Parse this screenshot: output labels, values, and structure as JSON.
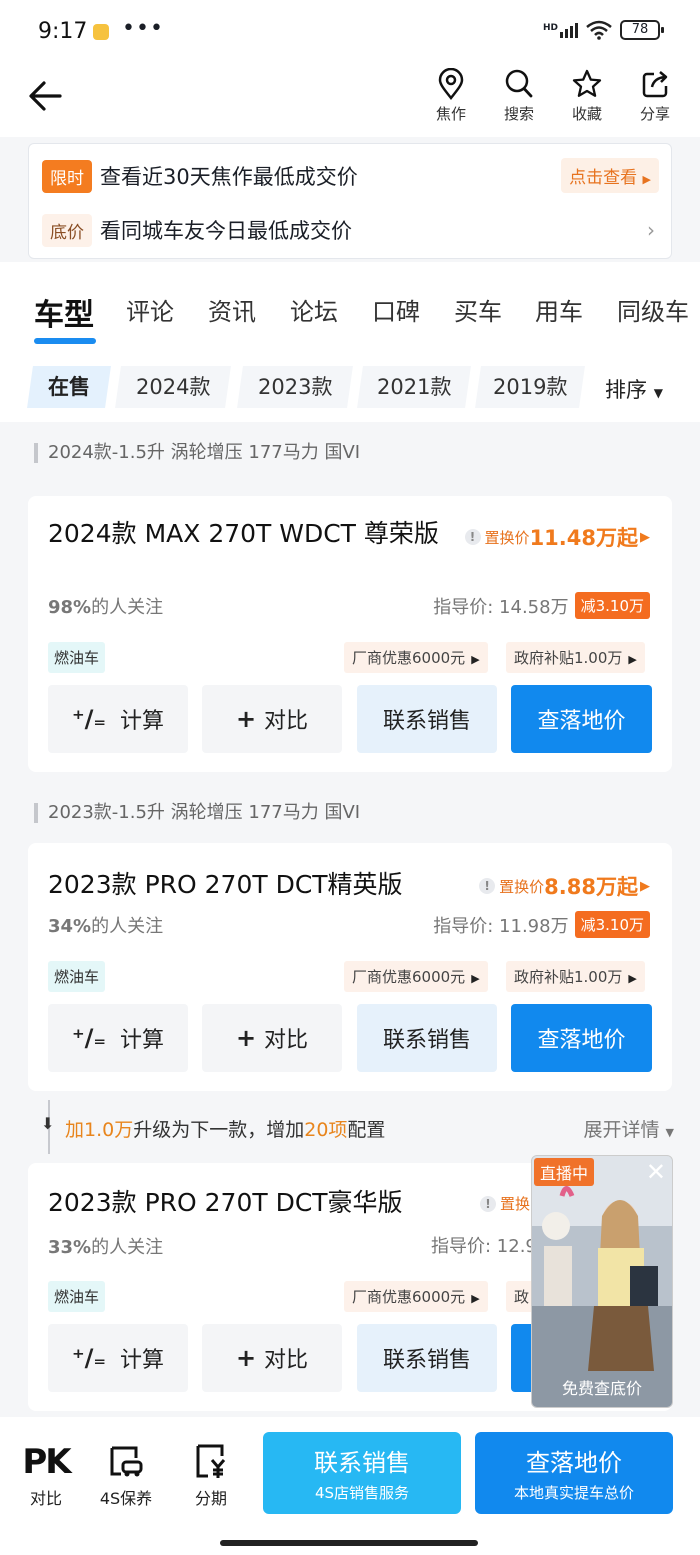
{
  "status_bar": {
    "time": "9:17",
    "dots": "•••",
    "network": "HD",
    "battery": "78"
  },
  "header": {
    "actions": [
      {
        "label": "焦作",
        "icon": "location-pin-icon"
      },
      {
        "label": "搜索",
        "icon": "search-icon"
      },
      {
        "label": "收藏",
        "icon": "star-icon"
      },
      {
        "label": "分享",
        "icon": "share-icon"
      }
    ]
  },
  "promo": {
    "row1_tag": "限时",
    "row1_text": "查看近30天焦作最低成交价",
    "row1_button": "点击查看",
    "row2_tag": "底价",
    "row2_text": "看同城车友今日最低成交价",
    "chevron": "›"
  },
  "tabs": [
    "车型",
    "评论",
    "资讯",
    "论坛",
    "口碑",
    "买车",
    "用车",
    "同级车"
  ],
  "year_filter": {
    "chips": [
      "在售",
      "2024款",
      "2023款",
      "2021款",
      "2019款"
    ],
    "sort_label": "排序"
  },
  "sections": [
    {
      "label": "2024款-1.5升 涡轮增压 177马力 国VI"
    },
    {
      "label": "2023款-1.5升 涡轮增压 177马力 国VI"
    }
  ],
  "cars": [
    {
      "title": "2024款 MAX 270T WDCT 尊荣版",
      "swap_label": "置换价",
      "swap_price": "11.48万起",
      "follow_pct": "98%",
      "follow_text": "的人关注",
      "guide_price": "指导价: 14.58万",
      "cut": "减3.10万",
      "fuel": "燃油车",
      "perk1": "厂商优惠6000元",
      "perk2": "政府补贴1.00万"
    },
    {
      "title": "2023款 PRO 270T DCT精英版",
      "swap_label": "置换价",
      "swap_price": "8.88万起",
      "follow_pct": "34%",
      "follow_text": "的人关注",
      "guide_price": "指导价: 11.98万",
      "cut": "减3.10万",
      "fuel": "燃油车",
      "perk1": "厂商优惠6000元",
      "perk2": "政府补贴1.00万"
    },
    {
      "title": "2023款 PRO 270T DCT豪华版",
      "swap_label": "置换",
      "follow_pct": "33%",
      "follow_text": "的人关注",
      "guide_price": "指导价: 12.9",
      "fuel": "燃油车",
      "perk1": "厂商优惠6000元",
      "perk2": "政"
    }
  ],
  "card_buttons": {
    "calc": "计算",
    "compare": "对比",
    "contact": "联系销售",
    "price": "查落地价"
  },
  "upgrade": {
    "prefix": "加1.0万",
    "mid": "升级为下一款，增加",
    "count": "20项",
    "suffix": "配置",
    "expand": "展开详情"
  },
  "live": {
    "badge": "直播中",
    "close": "✕",
    "caption": "免费查底价"
  },
  "bottom_bar": {
    "items": [
      {
        "label": "对比",
        "icon": "pk-icon"
      },
      {
        "label": "4S保养",
        "icon": "car-service-icon"
      },
      {
        "label": "分期",
        "icon": "installment-icon"
      }
    ],
    "contact_title": "联系销售",
    "contact_sub": "4S店销售服务",
    "price_title": "查落地价",
    "price_sub": "本地真实提车总价"
  },
  "colors": {
    "accent_blue": "#1189ee",
    "accent_orange": "#f07a1d",
    "cyan_button": "#27b8f3"
  }
}
